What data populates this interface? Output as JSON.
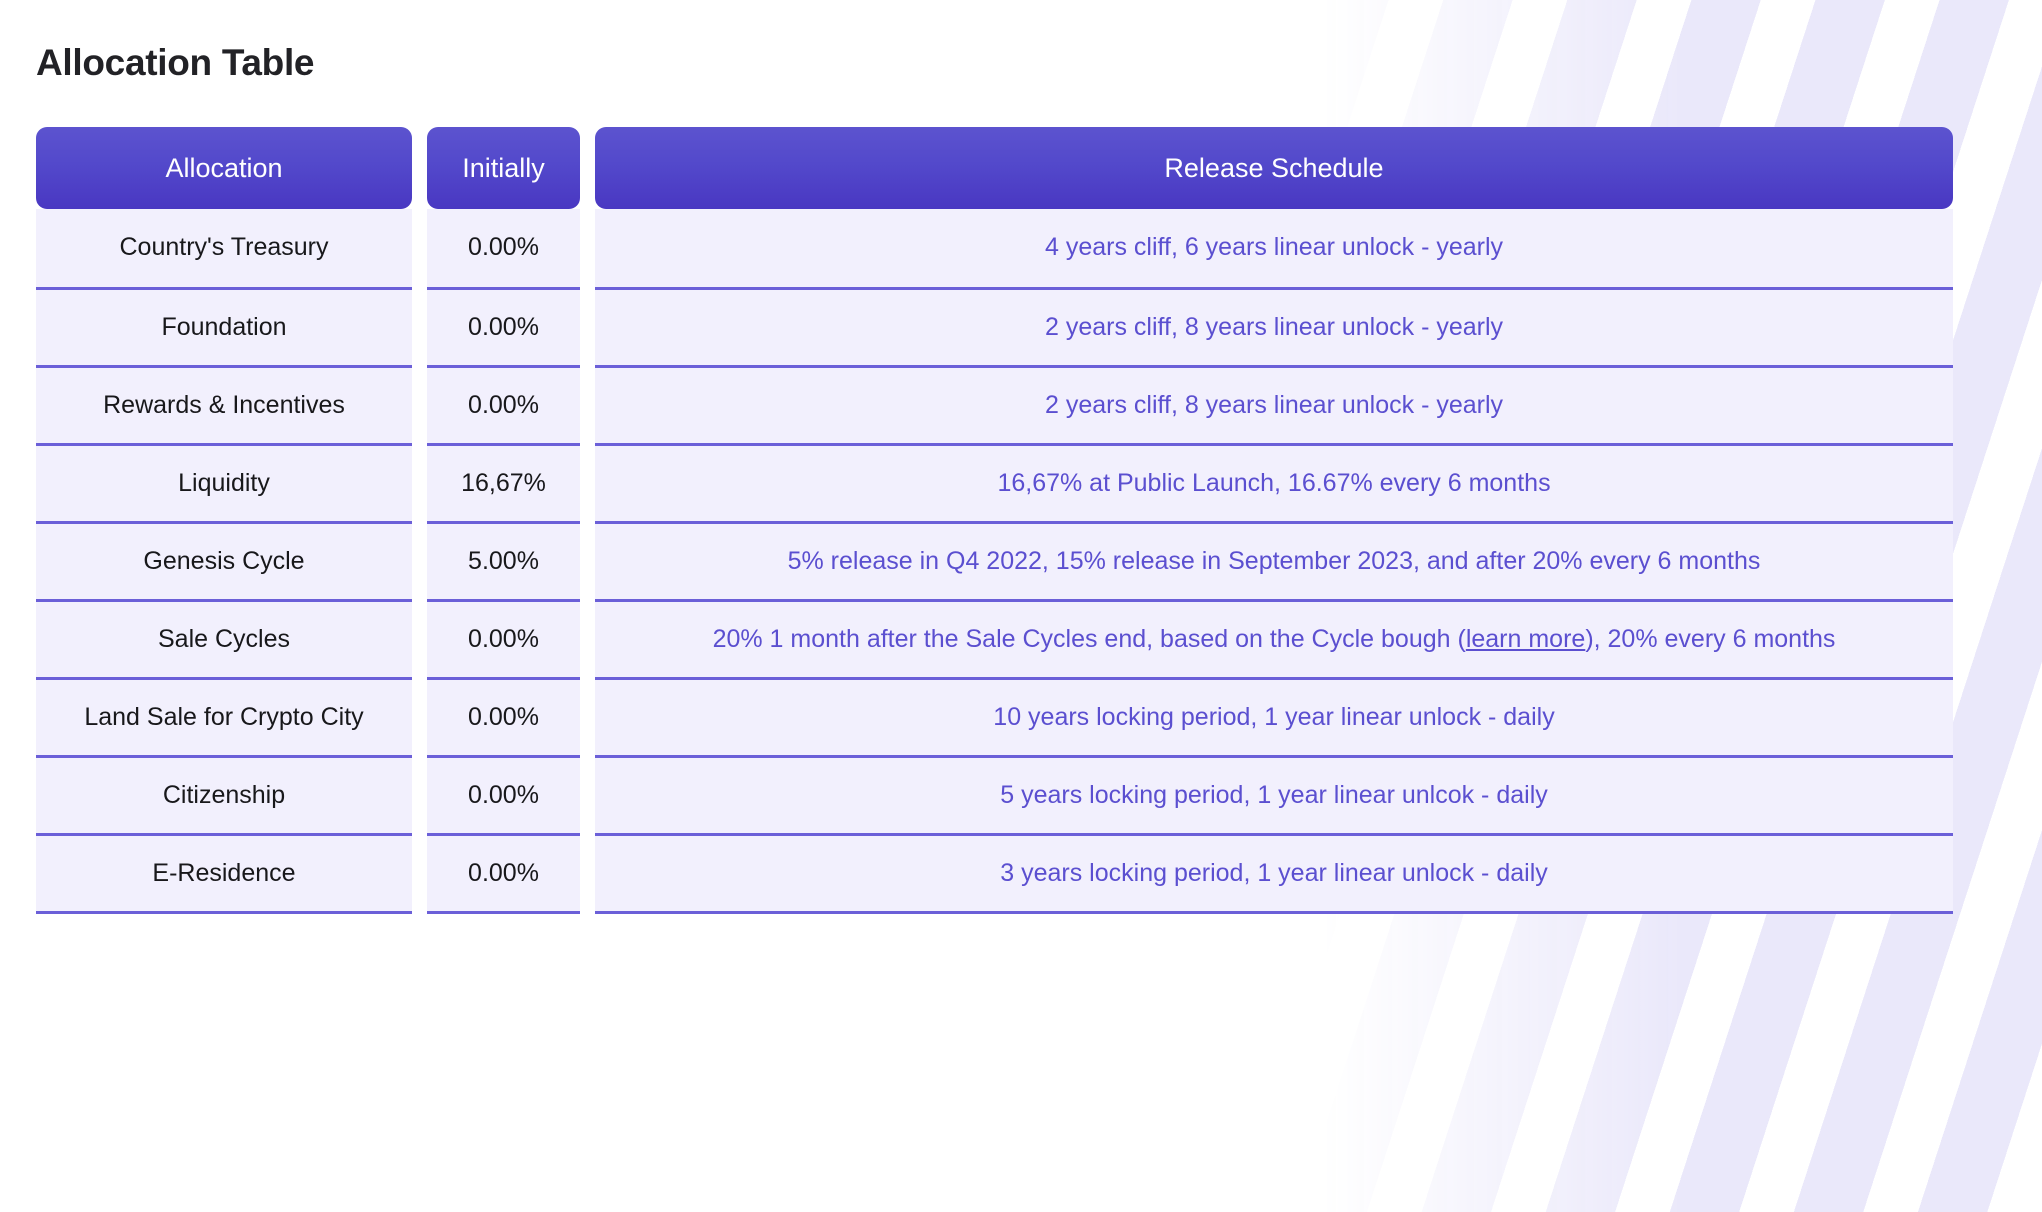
{
  "page_title": "Allocation Table",
  "colors": {
    "header_gradient_top": "#5c53cf",
    "header_gradient_bottom": "#4937c2",
    "row_background": "#f2f0fd",
    "row_separator": "#6b5fd8",
    "accent_text": "#5b4fd0",
    "primary_text": "#18181b",
    "header_text": "#ffffff"
  },
  "table": {
    "headers": {
      "allocation": "Allocation",
      "initially": "Initially",
      "release_schedule": "Release Schedule"
    },
    "rows": [
      {
        "allocation": "Country's Treasury",
        "initially": "0.00%",
        "release_schedule": "4 years cliff, 6 years linear unlock - yearly"
      },
      {
        "allocation": "Foundation",
        "initially": "0.00%",
        "release_schedule": "2 years cliff, 8 years linear unlock - yearly"
      },
      {
        "allocation": "Rewards & Incentives",
        "initially": "0.00%",
        "release_schedule": "2 years cliff, 8 years linear unlock - yearly"
      },
      {
        "allocation": "Liquidity",
        "initially": "16,67%",
        "release_schedule": "16,67% at Public Launch, 16.67% every 6 months"
      },
      {
        "allocation": "Genesis Cycle",
        "initially": "5.00%",
        "release_schedule": "5% release in Q4 2022, 15% release in September 2023, and after 20% every 6 months"
      },
      {
        "allocation": "Sale Cycles",
        "initially": "0.00%",
        "release_schedule_parts": {
          "before_link": "20% 1 month after the Sale Cycles end, based on the Cycle bough (",
          "link_text": "learn more",
          "after_link": "), 20% every 6 months"
        }
      },
      {
        "allocation": "Land Sale for Crypto City",
        "initially": "0.00%",
        "release_schedule": "10 years locking period, 1 year linear unlock - daily"
      },
      {
        "allocation": "Citizenship",
        "initially": "0.00%",
        "release_schedule": "5 years locking period, 1 year linear unlcok - daily"
      },
      {
        "allocation": "E-Residence",
        "initially": "0.00%",
        "release_schedule": "3 years locking period, 1 year linear unlock - daily"
      }
    ]
  }
}
